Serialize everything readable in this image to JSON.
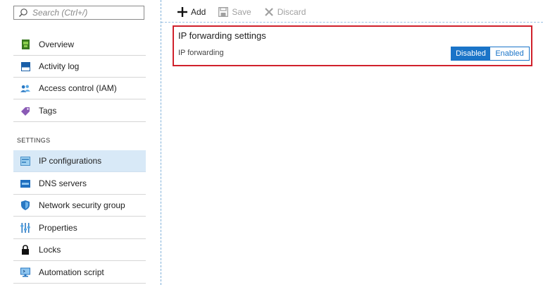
{
  "search": {
    "placeholder": "Search (Ctrl+/)"
  },
  "sidebar": {
    "items": [
      {
        "label": "Overview",
        "icon": "overview-icon"
      },
      {
        "label": "Activity log",
        "icon": "activity-log-icon"
      },
      {
        "label": "Access control (IAM)",
        "icon": "access-control-icon"
      },
      {
        "label": "Tags",
        "icon": "tag-icon"
      }
    ],
    "section_label": "SETTINGS",
    "settings_items": [
      {
        "label": "IP configurations",
        "icon": "ip-configurations-icon",
        "active": true
      },
      {
        "label": "DNS servers",
        "icon": "dns-servers-icon"
      },
      {
        "label": "Network security group",
        "icon": "shield-icon"
      },
      {
        "label": "Properties",
        "icon": "properties-icon"
      },
      {
        "label": "Locks",
        "icon": "lock-icon"
      },
      {
        "label": "Automation script",
        "icon": "automation-script-icon"
      }
    ]
  },
  "toolbar": {
    "add_label": "Add",
    "save_label": "Save",
    "discard_label": "Discard"
  },
  "panel": {
    "title": "IP forwarding settings",
    "field_label": "IP forwarding",
    "options": [
      "Disabled",
      "Enabled"
    ],
    "selected": "Disabled"
  },
  "colors": {
    "accent": "#1a74c8",
    "highlight_border": "#d0212c",
    "active_row": "#d8e9f7"
  }
}
